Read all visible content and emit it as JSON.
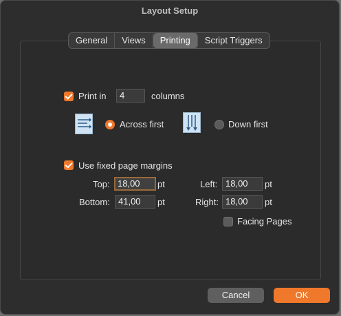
{
  "window": {
    "title": "Layout Setup"
  },
  "tabs": [
    {
      "label": "General"
    },
    {
      "label": "Views"
    },
    {
      "label": "Printing"
    },
    {
      "label": "Script Triggers"
    }
  ],
  "printing": {
    "print_in": {
      "label": "Print in",
      "checked": true,
      "value": "4",
      "suffix": "columns"
    },
    "direction": {
      "across_label": "Across first",
      "down_label": "Down first",
      "selected": "across"
    },
    "fixed_margins": {
      "label": "Use fixed page margins",
      "checked": true
    },
    "margins": {
      "top_label": "Top:",
      "top_value": "18,00",
      "bottom_label": "Bottom:",
      "bottom_value": "41,00",
      "left_label": "Left:",
      "left_value": "18,00",
      "right_label": "Right:",
      "right_value": "18,00",
      "unit": "pt"
    },
    "facing_pages": {
      "label": "Facing Pages",
      "checked": false
    }
  },
  "buttons": {
    "cancel": "Cancel",
    "ok": "OK"
  },
  "colors": {
    "accent": "#f0782a",
    "background": "#2d2d2d"
  }
}
